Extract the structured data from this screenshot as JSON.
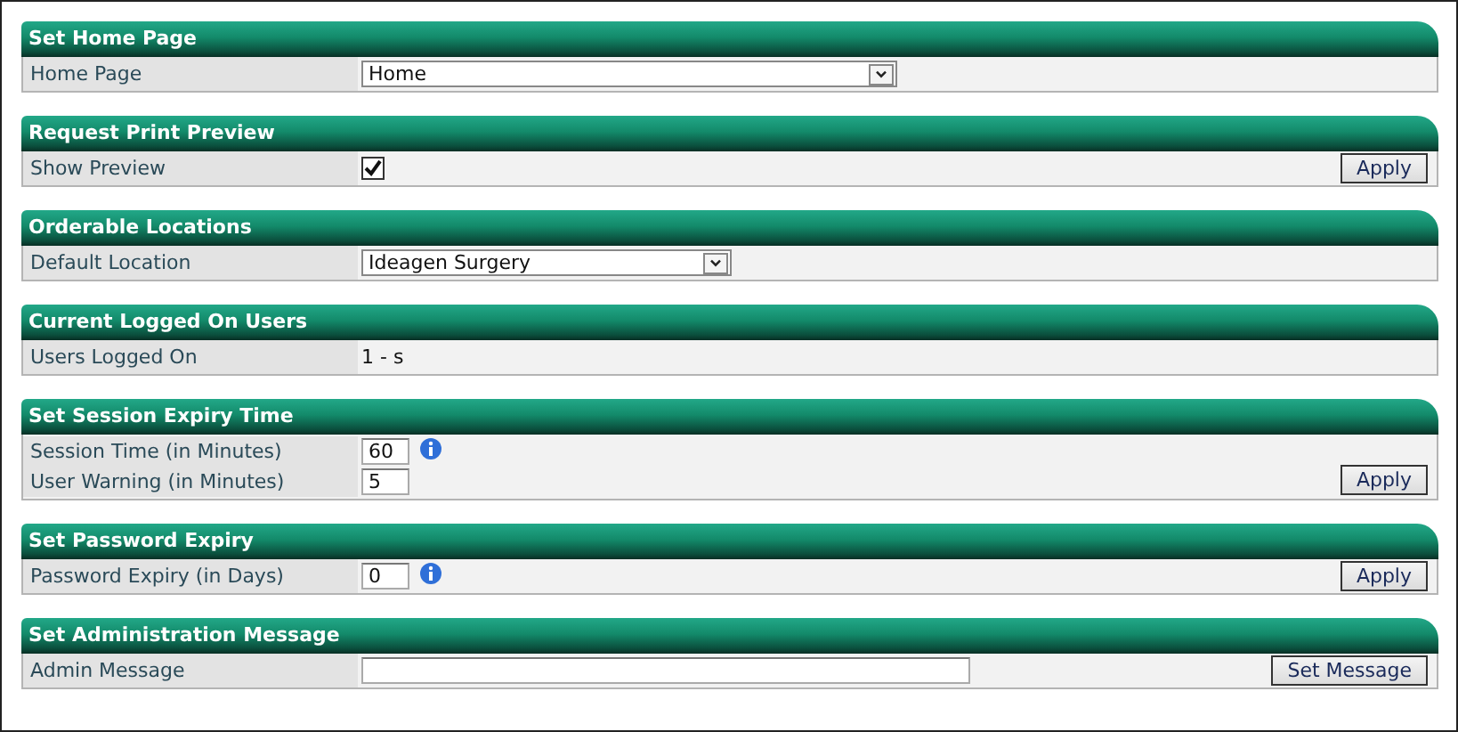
{
  "sections": [
    {
      "title": "Set Home Page",
      "rows": [
        {
          "label": "Home Page",
          "kind": "select",
          "value": "Home"
        }
      ]
    },
    {
      "title": "Request Print Preview",
      "rows": [
        {
          "label": "Show Preview",
          "kind": "checkbox",
          "checked": true
        }
      ],
      "button": "Apply"
    },
    {
      "title": "Orderable Locations",
      "rows": [
        {
          "label": "Default Location",
          "kind": "select",
          "value": "Ideagen Surgery"
        }
      ]
    },
    {
      "title": "Current Logged On Users",
      "rows": [
        {
          "label": "Users Logged On",
          "kind": "text",
          "value": "1 - s"
        }
      ]
    },
    {
      "title": "Set Session Expiry Time",
      "rows": [
        {
          "label": "Session Time (in Minutes)",
          "kind": "input",
          "value": "60",
          "info": true
        },
        {
          "label": "User Warning (in Minutes)",
          "kind": "input",
          "value": "5",
          "info": false
        }
      ],
      "button": "Apply"
    },
    {
      "title": "Set Password Expiry",
      "rows": [
        {
          "label": "Password Expiry (in Days)",
          "kind": "input",
          "value": "0",
          "info": true
        }
      ],
      "button": "Apply"
    },
    {
      "title": "Set Administration Message",
      "rows": [
        {
          "label": "Admin Message",
          "kind": "wideinput",
          "value": ""
        }
      ],
      "button": "Set Message"
    }
  ]
}
